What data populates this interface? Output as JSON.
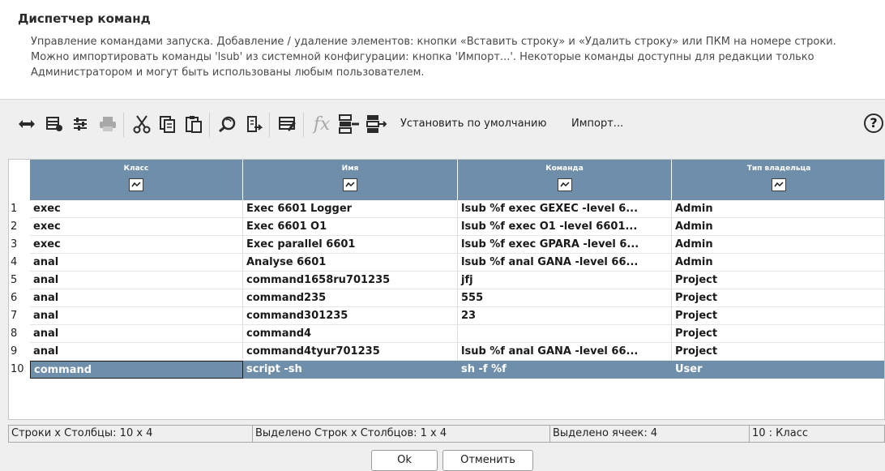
{
  "dialog": {
    "title": "Диспетчер команд",
    "description": "Управление командами запуска. Добавление / удаление элементов: кнопки «Вставить строку» и «Удалить строку» или ПКМ на номере строки. Можно импортировать команды 'lsub' из системной конфигурации: кнопка 'Импорт...'. Некоторые команды доступны для редакции только Администратором и могут быть использованы любым пользователем."
  },
  "toolbar": {
    "icons": [
      "fit-columns-icon",
      "table-settings-icon",
      "adjust-icon",
      "print-icon",
      "cut-icon",
      "copy-icon",
      "paste-icon",
      "find-icon",
      "export-icon",
      "edit-table-icon",
      "formula-icon",
      "insert-row-icon",
      "delete-row-icon"
    ],
    "set_default_label": "Установить по умолчанию",
    "import_label": "Импорт...",
    "help_label": "?"
  },
  "table": {
    "columns": [
      "Класс",
      "Имя",
      "Команда",
      "Тип владельца"
    ],
    "rows": [
      {
        "num": "1",
        "cells": [
          "exec",
          "Exec 6601 Logger",
          "lsub %f exec GEXEC -level 6...",
          "Admin"
        ]
      },
      {
        "num": "2",
        "cells": [
          "exec",
          "Exec 6601 O1",
          "lsub %f exec O1 -level 6601...",
          "Admin"
        ]
      },
      {
        "num": "3",
        "cells": [
          "exec",
          "Exec parallel 6601",
          "lsub %f exec GPARA -level 6...",
          "Admin"
        ]
      },
      {
        "num": "4",
        "cells": [
          "anal",
          "Analyse 6601",
          "lsub %f anal GANA -level 66...",
          "Admin"
        ]
      },
      {
        "num": "5",
        "cells": [
          "anal",
          "command1658ru701235",
          "jfj",
          "Project"
        ]
      },
      {
        "num": "6",
        "cells": [
          "anal",
          "command235",
          "555",
          "Project"
        ]
      },
      {
        "num": "7",
        "cells": [
          "anal",
          "command301235",
          "23",
          "Project"
        ]
      },
      {
        "num": "8",
        "cells": [
          "anal",
          "command4",
          "",
          "Project"
        ]
      },
      {
        "num": "9",
        "cells": [
          "anal",
          "command4tyur701235",
          "lsub %f anal GANA -level 66...",
          "Project"
        ]
      },
      {
        "num": "10",
        "cells": [
          "command",
          "script -sh",
          "sh -f %f",
          "User"
        ]
      }
    ],
    "selected_row": 10,
    "header_color": "#6e8ea9"
  },
  "status": {
    "rows_cols": "Строки x Столбцы: 10 x 4",
    "selected_rows_cols": "Выделено Строк x Столбцов: 1 x 4",
    "selected_cells": "Выделено ячеек: 4",
    "current_cell": "10 : Класс"
  },
  "buttons": {
    "ok_label": "Ok",
    "cancel_label": "Отменить"
  }
}
